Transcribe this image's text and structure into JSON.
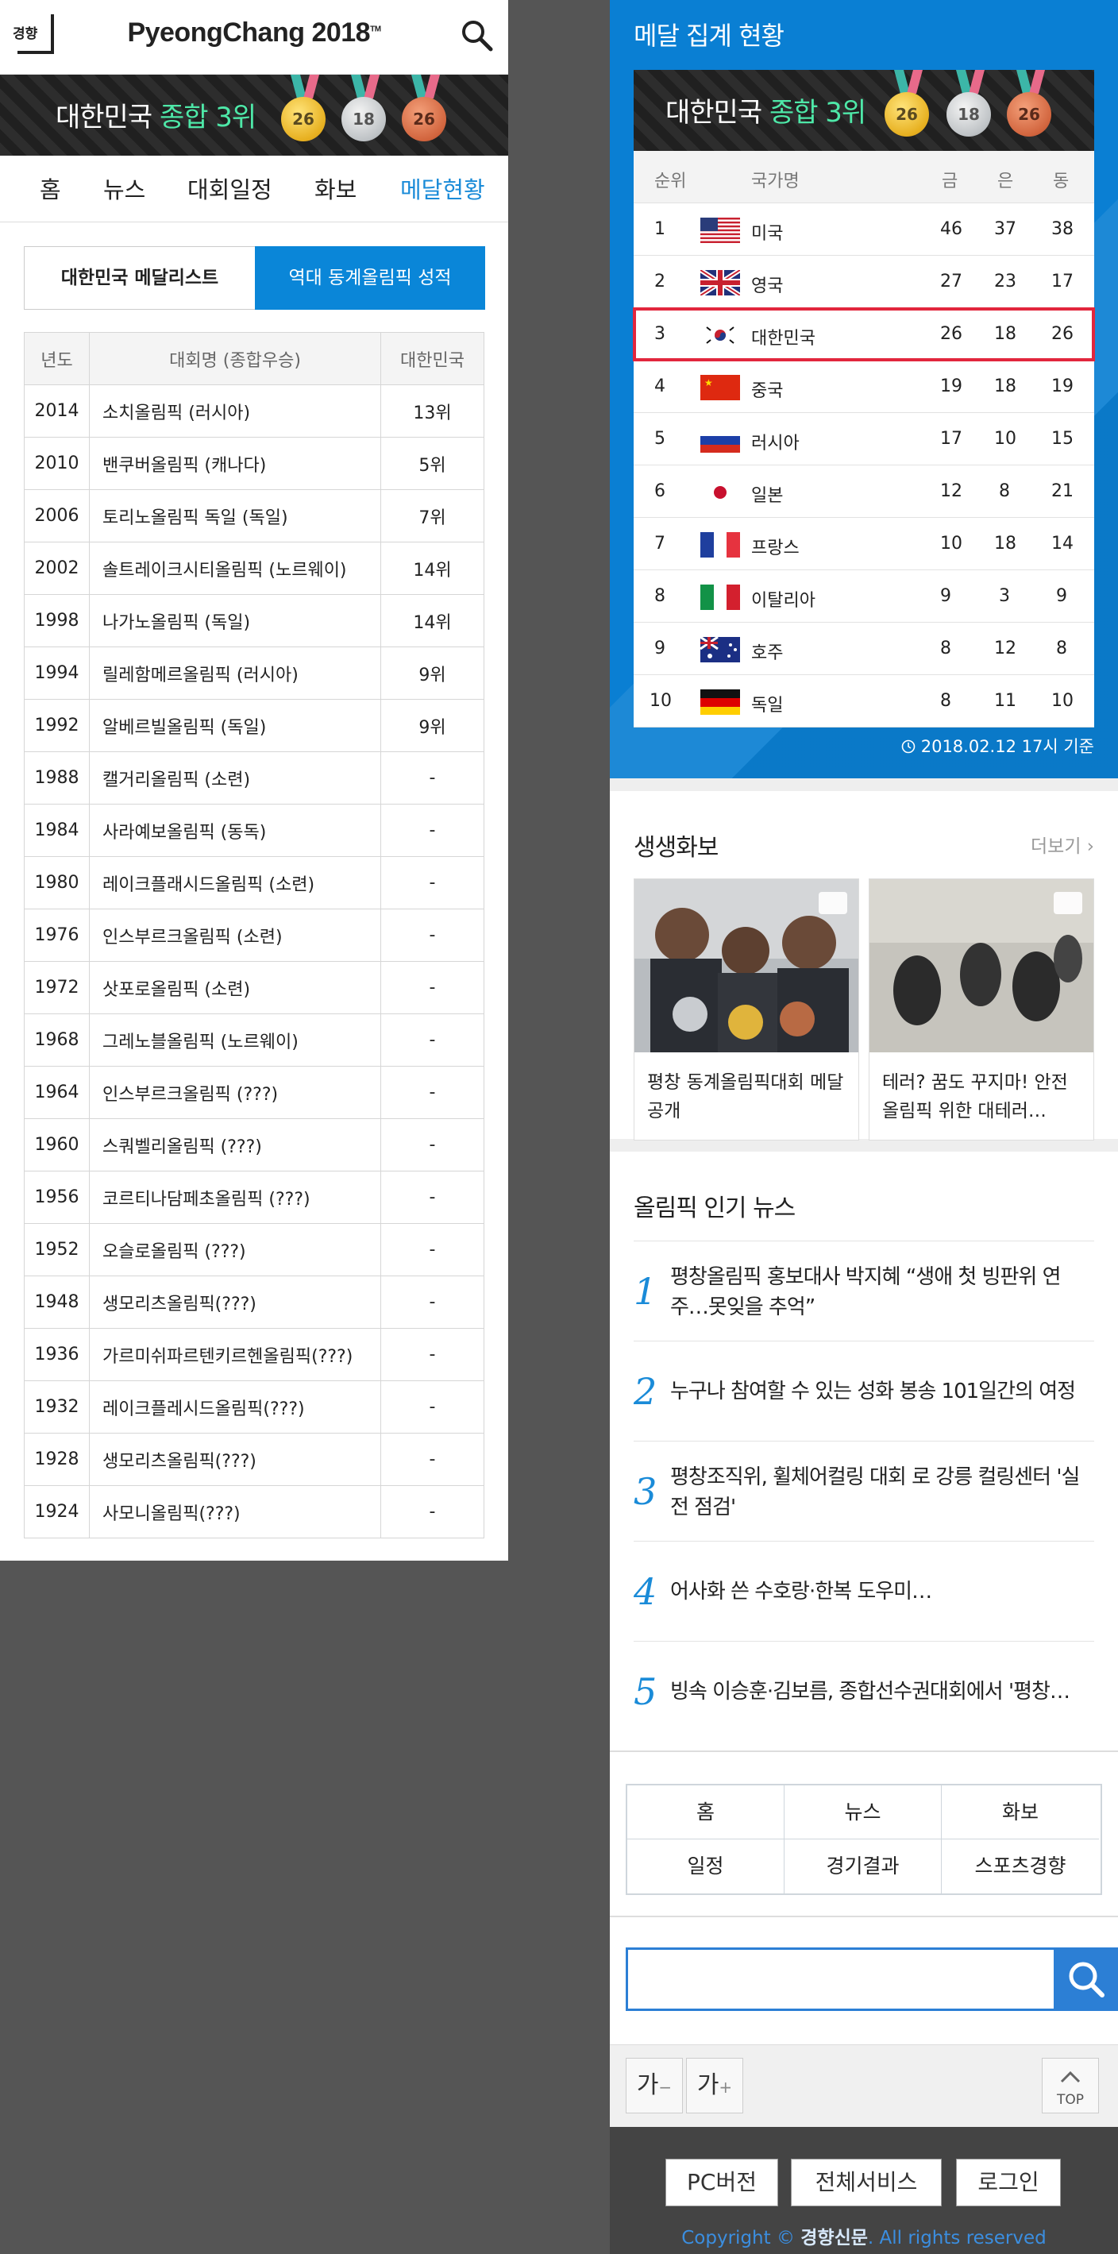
{
  "left": {
    "header": {
      "logo_text": "경향",
      "brand": "PyeongChang 2018",
      "brand_tm": "TM"
    },
    "banner": {
      "country": "대한민국",
      "rank_text": "종합 3위",
      "gold": "26",
      "silver": "18",
      "bronze": "26"
    },
    "nav": [
      "홈",
      "뉴스",
      "대회일정",
      "화보",
      "메달현황"
    ],
    "tabs": {
      "medalist": "대한민국 메달리스트",
      "history": "역대 동계올림픽 성적"
    },
    "history_table": {
      "headers": [
        "년도",
        "대회명 (종합우승)",
        "대한민국"
      ],
      "rows": [
        [
          "2014",
          "소치올림픽 (러시아)",
          "13위"
        ],
        [
          "2010",
          "밴쿠버올림픽 (캐나다)",
          "5위"
        ],
        [
          "2006",
          "토리노올림픽 독일 (독일)",
          "7위"
        ],
        [
          "2002",
          "솔트레이크시티올림픽 (노르웨이)",
          "14위"
        ],
        [
          "1998",
          "나가노올림픽 (독일)",
          "14위"
        ],
        [
          "1994",
          "릴레함메르올림픽 (러시아)",
          "9위"
        ],
        [
          "1992",
          "알베르빌올림픽 (독일)",
          "9위"
        ],
        [
          "1988",
          "캘거리올림픽 (소련)",
          "-"
        ],
        [
          "1984",
          "사라예보올림픽 (동독)",
          "-"
        ],
        [
          "1980",
          "레이크플래시드올림픽 (소련)",
          "-"
        ],
        [
          "1976",
          "인스부르크올림픽 (소련)",
          "-"
        ],
        [
          "1972",
          "삿포로올림픽 (소련)",
          "-"
        ],
        [
          "1968",
          "그레노블올림픽 (노르웨이)",
          "-"
        ],
        [
          "1964",
          "인스부르크올림픽 (???)",
          "-"
        ],
        [
          "1960",
          "스쿼벨리올림픽 (???)",
          "-"
        ],
        [
          "1956",
          "코르티나담페초올림픽 (???)",
          "-"
        ],
        [
          "1952",
          "오슬로올림픽 (???)",
          "-"
        ],
        [
          "1948",
          "생모리츠올림픽(???)",
          "-"
        ],
        [
          "1936",
          "가르미쉬파르텐키르헨올림픽(???)",
          "-"
        ],
        [
          "1932",
          "레이크플레시드올림픽(???)",
          "-"
        ],
        [
          "1928",
          "생모리츠올림픽(???)",
          "-"
        ],
        [
          "1924",
          "사모니올림픽(???)",
          "-"
        ]
      ]
    }
  },
  "right": {
    "panel_title": "메달 집계 현황",
    "banner": {
      "country": "대한민국",
      "rank_text": "종합 3위",
      "gold": "26",
      "silver": "18",
      "bronze": "26"
    },
    "medal_table": {
      "headers": [
        "순위",
        "국가명",
        "금",
        "은",
        "동"
      ],
      "rows": [
        {
          "rank": "1",
          "country": "미국",
          "flag": "us-flag",
          "g": "46",
          "s": "37",
          "b": "38"
        },
        {
          "rank": "2",
          "country": "영국",
          "flag": "uk-flag",
          "g": "27",
          "s": "23",
          "b": "17"
        },
        {
          "rank": "3",
          "country": "대한민국",
          "flag": "kr-flag",
          "g": "26",
          "s": "18",
          "b": "26"
        },
        {
          "rank": "4",
          "country": "중국",
          "flag": "cn-flag",
          "g": "19",
          "s": "18",
          "b": "19"
        },
        {
          "rank": "5",
          "country": "러시아",
          "flag": "ru-flag",
          "g": "17",
          "s": "10",
          "b": "15"
        },
        {
          "rank": "6",
          "country": "일본",
          "flag": "jp-flag",
          "g": "12",
          "s": "8",
          "b": "21"
        },
        {
          "rank": "7",
          "country": "프랑스",
          "flag": "fr-flag",
          "g": "10",
          "s": "18",
          "b": "14"
        },
        {
          "rank": "8",
          "country": "이탈리아",
          "flag": "it-flag",
          "g": "9",
          "s": "3",
          "b": "9"
        },
        {
          "rank": "9",
          "country": "호주",
          "flag": "au-flag",
          "g": "8",
          "s": "12",
          "b": "8"
        },
        {
          "rank": "10",
          "country": "독일",
          "flag": "de-flag",
          "g": "8",
          "s": "11",
          "b": "10"
        }
      ]
    },
    "updated": "2018.02.12 17시 기준",
    "gallery": {
      "title": "생생화보",
      "more": "더보기",
      "items": [
        {
          "caption": "평창 동계올림픽대회 메달 공개"
        },
        {
          "caption": "테러? 꿈도 꾸지마! 안전 올림픽 위한 대테러…"
        }
      ]
    },
    "news": {
      "title": "올림픽 인기 뉴스",
      "items": [
        {
          "num": "1",
          "text": "평창올림픽 홍보대사 박지혜 “생애 첫 빙판위 연주…못잊을 추억”"
        },
        {
          "num": "2",
          "text": "누구나 참여할 수 있는 성화 봉송 101일간의 여정"
        },
        {
          "num": "3",
          "text": "평창조직위, 휠체어컬링 대회 로 강릉 컬링센터 '실전 점검'"
        },
        {
          "num": "4",
          "text": "어사화 쓴 수호랑·한복 도우미…"
        },
        {
          "num": "5",
          "text": "빙속 이승훈·김보름, 종합선수권대회에서 '평창…"
        }
      ]
    },
    "menu_grid": [
      "홈",
      "뉴스",
      "화보",
      "일정",
      "경기결과",
      "스포츠경향"
    ],
    "search": {
      "placeholder": ""
    },
    "font_buttons": {
      "smaller": "가",
      "larger": "가",
      "top": "TOP"
    },
    "footer": {
      "pc": "PC버전",
      "all": "전체서비스",
      "login": "로그인",
      "copyright_pre": "Copyright ©",
      "brand": "경향신문",
      "copyright_post": ". All rights reserved"
    }
  },
  "colors": {
    "accent": "#0a86d8",
    "green": "#4ee8a8",
    "highlight": "#e2263d",
    "search": "#2c7fd5"
  }
}
